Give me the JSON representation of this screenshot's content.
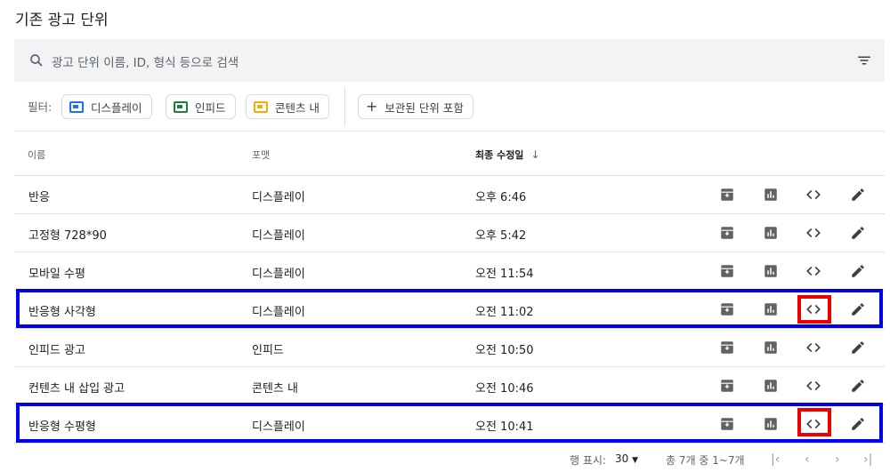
{
  "page": {
    "title": "기존 광고 단위"
  },
  "search": {
    "placeholder": "광고 단위 이름, ID, 형식 등으로 검색"
  },
  "filters": {
    "label": "필터:",
    "chips": [
      {
        "label": "디스플레이",
        "icon": "display-ad-icon",
        "color": "#1a73e8"
      },
      {
        "label": "인피드",
        "icon": "infeed-ad-icon",
        "color": "#188038"
      },
      {
        "label": "콘텐츠 내",
        "icon": "incontent-ad-icon",
        "color": "#f9ab00"
      }
    ],
    "archived_label": "보관된 단위 포함"
  },
  "table": {
    "columns": [
      "이름",
      "포맷",
      "최종 수정일"
    ],
    "sort_indicator": "↓",
    "rows": [
      {
        "name": "반응",
        "format": "디스플레이",
        "modified": "오후 6:46"
      },
      {
        "name": "고정형 728*90",
        "format": "디스플레이",
        "modified": "오후 5:42"
      },
      {
        "name": "모바일 수평",
        "format": "디스플레이",
        "modified": "오전 11:54"
      },
      {
        "name": "반응형 사각형",
        "format": "디스플레이",
        "modified": "오전 11:02"
      },
      {
        "name": "인피드 광고",
        "format": "인피드",
        "modified": "오전 10:50"
      },
      {
        "name": "컨텐츠 내 삽입 광고",
        "format": "콘텐츠 내",
        "modified": "오전 10:46"
      },
      {
        "name": "반응형 수평형",
        "format": "디스플레이",
        "modified": "오전 10:41"
      }
    ]
  },
  "pagination": {
    "rows_per_page_label": "행 표시:",
    "rows_per_page": "30",
    "range": "총 7개 중 1~7개"
  },
  "colors": {
    "highlight_row": "#0000ee",
    "highlight_code": "#ee0000"
  }
}
